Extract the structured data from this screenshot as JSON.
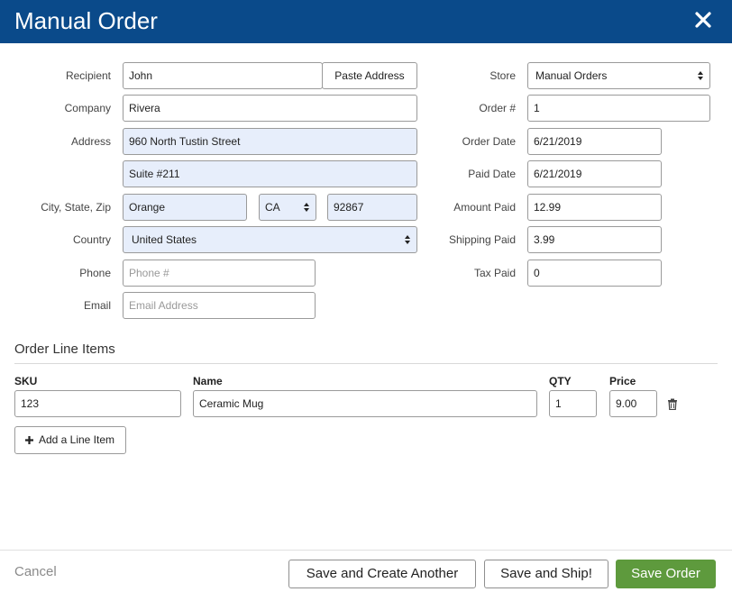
{
  "header": {
    "title": "Manual Order",
    "close_icon": "close-icon"
  },
  "recipient": {
    "recipient_label": "Recipient",
    "recipient_value": "John",
    "paste_label": "Paste Address",
    "company_label": "Company",
    "company_value": "Rivera",
    "address_label": "Address",
    "address1_value": "960 North Tustin Street",
    "address2_value": "Suite #211",
    "csz_label": "City, State, Zip",
    "city_value": "Orange",
    "state_value": "CA",
    "zip_value": "92867",
    "country_label": "Country",
    "country_value": "United States",
    "phone_label": "Phone",
    "phone_placeholder": "Phone #",
    "email_label": "Email",
    "email_placeholder": "Email Address"
  },
  "order": {
    "store_label": "Store",
    "store_value": "Manual Orders",
    "order_num_label": "Order #",
    "order_num_value": "1",
    "order_date_label": "Order Date",
    "order_date_value": "6/21/2019",
    "paid_date_label": "Paid Date",
    "paid_date_value": "6/21/2019",
    "amount_paid_label": "Amount Paid",
    "amount_paid_value": "12.99",
    "shipping_paid_label": "Shipping Paid",
    "shipping_paid_value": "3.99",
    "tax_paid_label": "Tax Paid",
    "tax_paid_value": "0"
  },
  "line_items": {
    "title": "Order Line Items",
    "columns": {
      "sku": "SKU",
      "name": "Name",
      "qty": "QTY",
      "price": "Price"
    },
    "rows": [
      {
        "sku": "123",
        "name": "Ceramic Mug",
        "qty": "1",
        "price": "9.00"
      }
    ],
    "add_label": "Add a Line Item"
  },
  "footer": {
    "cancel": "Cancel",
    "save_create_another": "Save and Create Another",
    "save_ship": "Save and Ship!",
    "save_order": "Save Order"
  },
  "colors": {
    "header_bg": "#0a4a8a",
    "primary_button": "#5e9a3d",
    "filled_field_bg": "#e7eefb"
  }
}
